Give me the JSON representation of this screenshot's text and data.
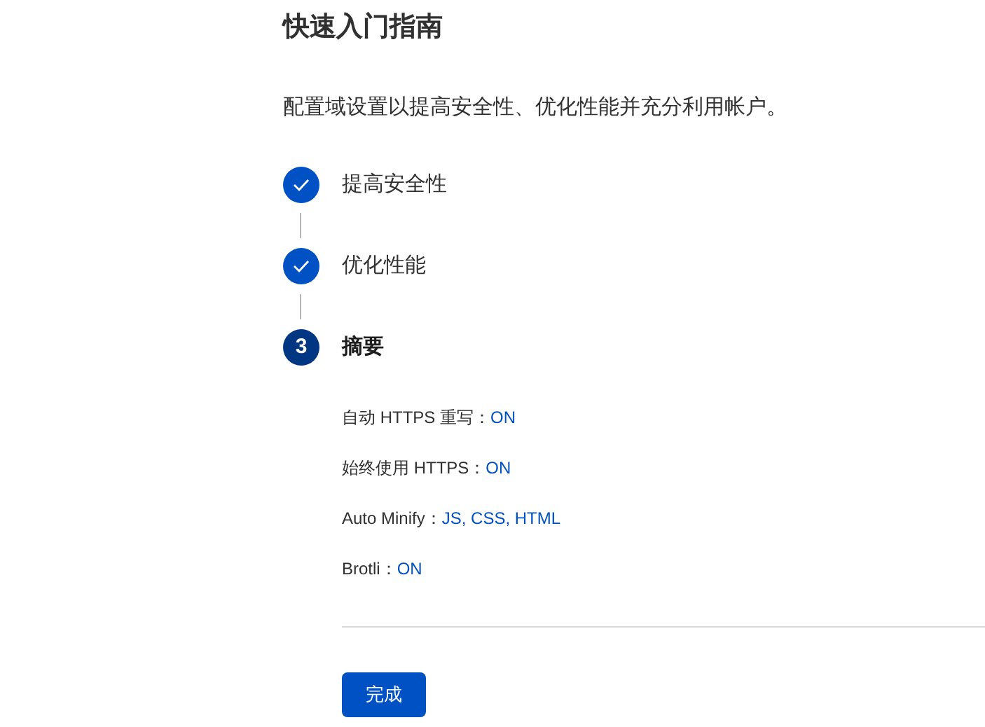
{
  "title": "快速入门指南",
  "description": "配置域设置以提高安全性、优化性能并充分利用帐户。",
  "steps": [
    {
      "label": "提高安全性",
      "completed": true,
      "current": false
    },
    {
      "label": "优化性能",
      "completed": true,
      "current": false
    },
    {
      "label": "摘要",
      "number": "3",
      "completed": false,
      "current": true
    }
  ],
  "summary": [
    {
      "label": "自动 HTTPS 重写：",
      "value": "ON"
    },
    {
      "label": "始终使用 HTTPS：",
      "value": "ON"
    },
    {
      "label": "Auto Minify：",
      "value": "JS, CSS, HTML"
    },
    {
      "label": "Brotli：",
      "value": "ON"
    }
  ],
  "button": "完成"
}
